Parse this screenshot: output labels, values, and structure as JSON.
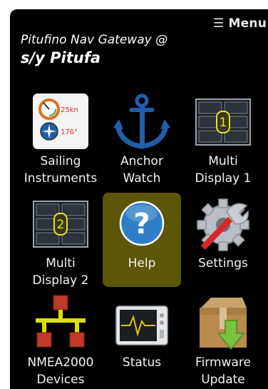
{
  "header": {
    "menu_label": "Menu",
    "gateway_title": "Pitufino Nav Gateway @",
    "vessel_name": "s/y Pitufa"
  },
  "tiles": [
    {
      "line1": "Sailing",
      "line2": "Instruments",
      "icon": "sailing-instruments-icon",
      "speed": "25kn",
      "heading": "176°"
    },
    {
      "line1": "Anchor",
      "line2": "Watch",
      "icon": "anchor-icon"
    },
    {
      "line1": "Multi",
      "line2": "Display 1",
      "icon": "multi-display-icon",
      "number": "1"
    },
    {
      "line1": "Multi",
      "line2": "Display 2",
      "icon": "multi-display-icon",
      "number": "2"
    },
    {
      "line1": "Help",
      "line2": "",
      "icon": "help-icon",
      "glyph": "?"
    },
    {
      "line1": "Settings",
      "line2": "",
      "icon": "settings-icon"
    },
    {
      "line1": "NMEA2000",
      "line2": "Devices",
      "icon": "network-icon"
    },
    {
      "line1": "Status",
      "line2": "",
      "icon": "status-monitor-icon"
    },
    {
      "line1": "Firmware",
      "line2": "Update",
      "icon": "firmware-box-icon"
    }
  ],
  "colors": {
    "background": "#000000",
    "active_tile": "#5c5609",
    "anchor_blue": "#1f5fa8",
    "help_blue": "#2f7fc8",
    "network_red": "#c0392b",
    "network_line": "#d8e000",
    "firmware_green": "#7cc242"
  }
}
